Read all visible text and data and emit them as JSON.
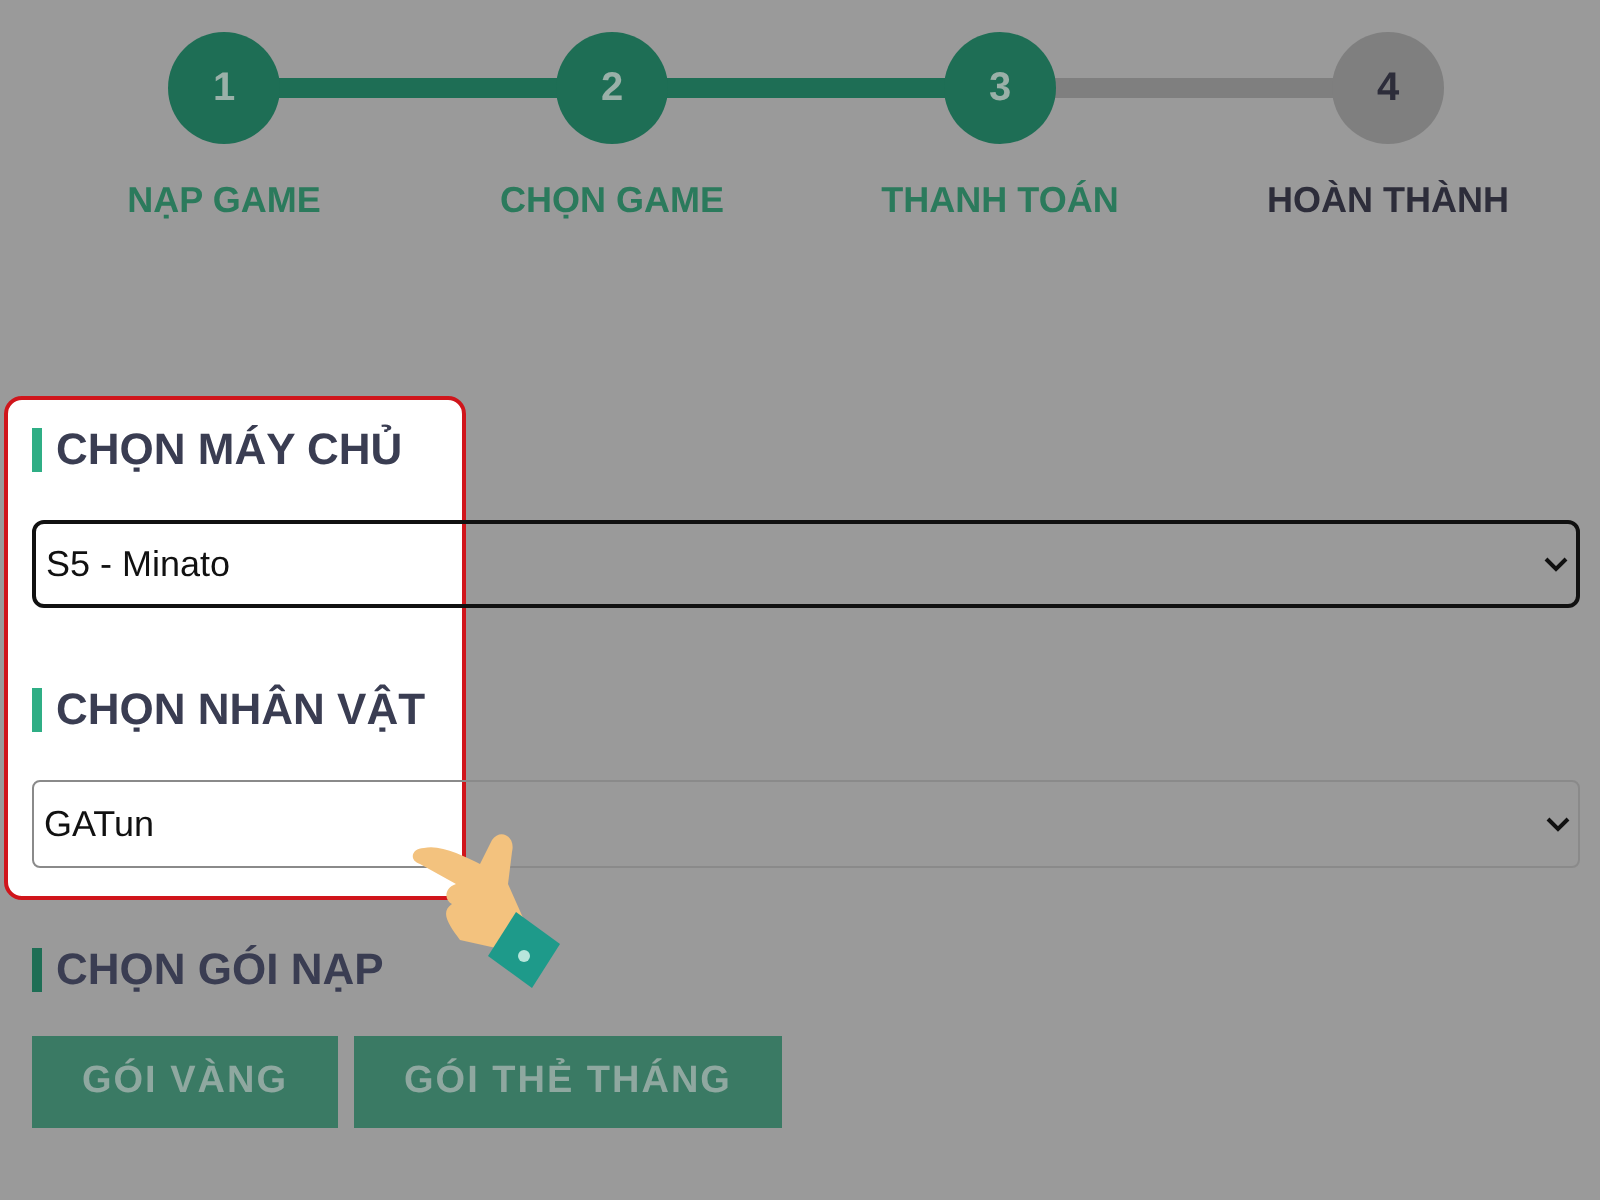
{
  "steps": [
    {
      "number": "1",
      "label": "NẠP GAME",
      "completed": true
    },
    {
      "number": "2",
      "label": "CHỌN GAME",
      "completed": true
    },
    {
      "number": "3",
      "label": "THANH TOÁN",
      "completed": true
    },
    {
      "number": "4",
      "label": "HOÀN THÀNH",
      "completed": false
    }
  ],
  "sections": [
    {
      "title": "CHỌN MÁY CHỦ",
      "value": "S5 - Minato",
      "focused": true
    },
    {
      "title": "CHỌN NHÂN VẬT",
      "value": "GATun",
      "focused": false
    }
  ],
  "packages": {
    "title": "CHỌN GÓI NẠP",
    "buttons": [
      "GÓI VÀNG",
      "GÓI THẺ THÁNG"
    ]
  }
}
